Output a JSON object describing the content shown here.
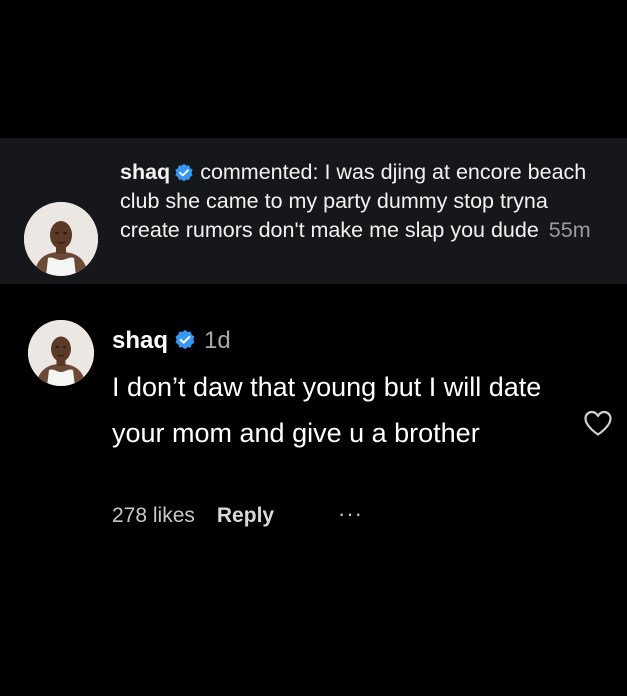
{
  "notification": {
    "username": "shaq",
    "verified_icon": "verified-badge-icon",
    "action": "commented:",
    "text": "I was djing at encore beach club she came to my party dummy stop tryna create rumors don't make me slap you dude",
    "time": "55m"
  },
  "comment": {
    "username": "shaq",
    "verified_icon": "verified-badge-icon",
    "time": "1d",
    "text": "I don’t daw that young but I will date your mom and give u a brother",
    "likes": "278 likes",
    "reply_label": "Reply",
    "more_label": "···",
    "like_icon": "heart-outline-icon"
  },
  "colors": {
    "background": "#000000",
    "card_background": "#16171b",
    "verified_blue": "#3797f0",
    "muted_text": "#9a9aa0"
  }
}
